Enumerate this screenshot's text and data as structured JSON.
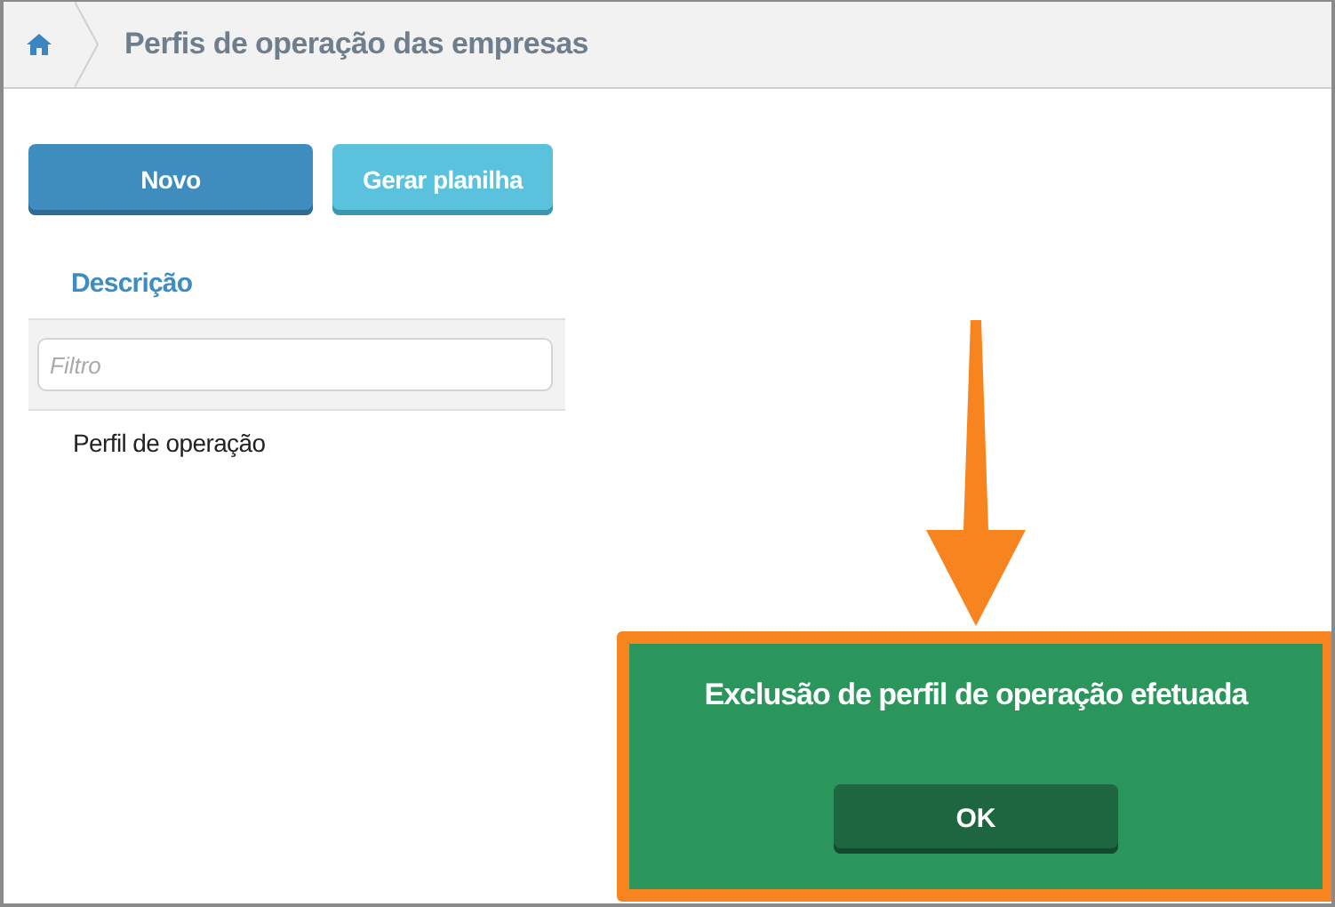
{
  "breadcrumb": {
    "title": "Perfis de operação das empresas"
  },
  "buttons": [
    {
      "label": "Novo",
      "kind": "primary"
    },
    {
      "label": "Gerar planilha",
      "kind": "secondary"
    }
  ],
  "table": {
    "columns": [
      {
        "label": "Descrição"
      }
    ],
    "filter": {
      "placeholder": "Filtro"
    },
    "rows": [
      {
        "cells": [
          "Perfil de operação"
        ]
      }
    ]
  },
  "toast": {
    "message": "Exclusão de perfil de operação efetuada",
    "button": "OK"
  }
}
